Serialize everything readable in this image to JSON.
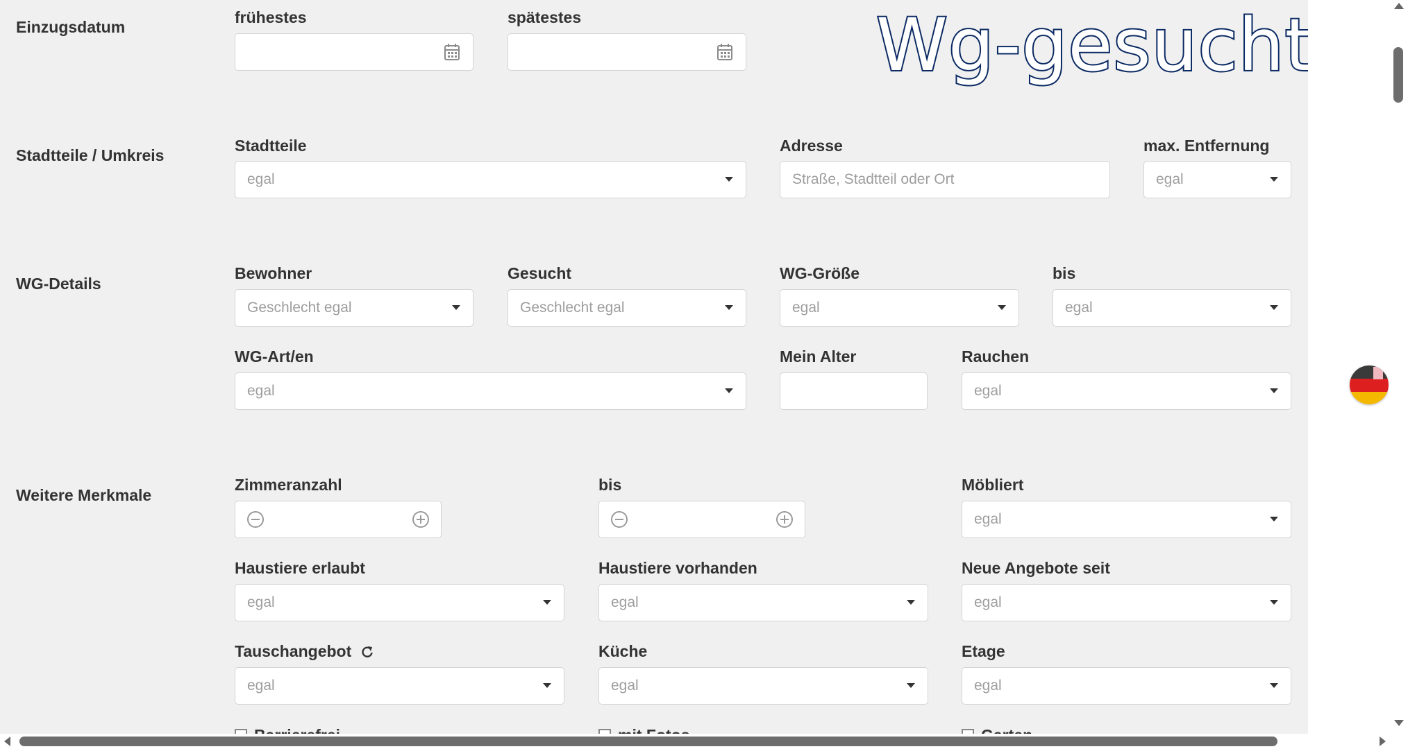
{
  "brand": "Wg-gesucht",
  "sections": {
    "einzugsdatum": "Einzugsdatum",
    "stadtteile_umkreis": "Stadtteile / Umkreis",
    "wg_details": "WG-Details",
    "weitere_merkmale": "Weitere Merkmale"
  },
  "einzugsdatum": {
    "fruehestes_label": "frühestes",
    "spaetestes_label": "spätestes"
  },
  "location": {
    "stadtteile_label": "Stadtteile",
    "stadtteile_value": "egal",
    "adresse_label": "Adresse",
    "adresse_placeholder": "Straße, Stadtteil oder Ort",
    "entfernung_label": "max. Entfernung",
    "entfernung_value": "egal"
  },
  "wg_details": {
    "bewohner_label": "Bewohner",
    "bewohner_value": "Geschlecht egal",
    "gesucht_label": "Gesucht",
    "gesucht_value": "Geschlecht egal",
    "groesse_label": "WG-Größe",
    "groesse_value": "egal",
    "groesse_bis_label": "bis",
    "groesse_bis_value": "egal",
    "art_label": "WG-Art/en",
    "art_value": "egal",
    "alter_label": "Mein Alter",
    "rauchen_label": "Rauchen",
    "rauchen_value": "egal"
  },
  "merkmale": {
    "zimmer_label": "Zimmeranzahl",
    "zimmer_bis_label": "bis",
    "moebliert_label": "Möbliert",
    "moebliert_value": "egal",
    "haustiere_erlaubt_label": "Haustiere erlaubt",
    "haustiere_erlaubt_value": "egal",
    "haustiere_vorhanden_label": "Haustiere vorhanden",
    "haustiere_vorhanden_value": "egal",
    "neue_angebote_label": "Neue Angebote seit",
    "neue_angebote_value": "egal",
    "tausch_label": "Tauschangebot",
    "tausch_value": "egal",
    "kueche_label": "Küche",
    "kueche_value": "egal",
    "etage_label": "Etage",
    "etage_value": "egal",
    "barrierefrei_label": "Barrierefrei",
    "mit_fotos_label": "mit Fotos",
    "garten_label": "Garten"
  },
  "colors": {
    "page_bg": "#f0f0f0",
    "brand_outline": "#0b2a63",
    "label_text": "#333333",
    "placeholder_text": "#9e9e9e"
  },
  "icons": [
    "calendar-icon",
    "chevron-down-icon",
    "minus-circle-icon",
    "plus-circle-icon",
    "refresh-icon",
    "flag-de-icon"
  ]
}
